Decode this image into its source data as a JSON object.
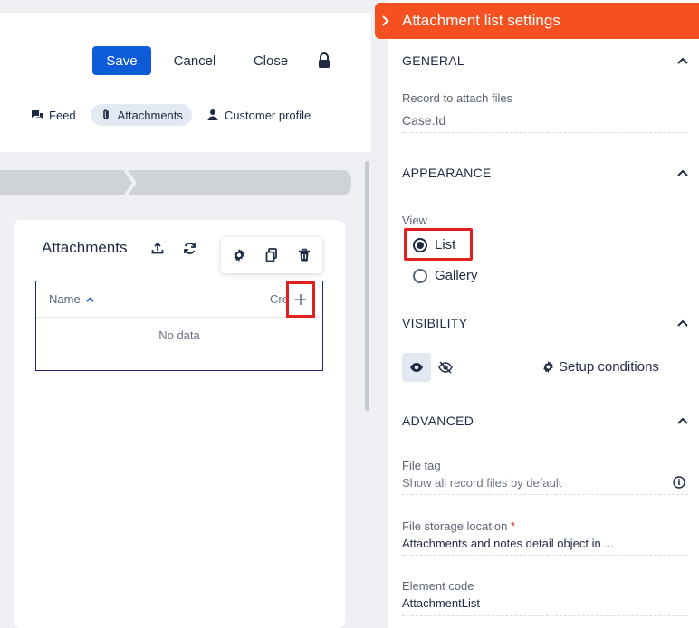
{
  "toolbar": {
    "save_label": "Save",
    "cancel_label": "Cancel",
    "close_label": "Close"
  },
  "tabs": [
    {
      "label": "Feed",
      "icon": "feed-icon",
      "active": false
    },
    {
      "label": "Attachments",
      "icon": "paperclip-icon",
      "active": true
    },
    {
      "label": "Customer profile",
      "icon": "person-icon",
      "active": false
    }
  ],
  "card": {
    "title": "Attachments",
    "table": {
      "col_name": "Name",
      "col_created": "Cre",
      "empty": "No data"
    }
  },
  "panel": {
    "title": "Attachment list settings",
    "general": {
      "title": "GENERAL",
      "record_label": "Record to attach files",
      "record_value": "Case.Id"
    },
    "appearance": {
      "title": "APPEARANCE",
      "view_label": "View",
      "option_list": "List",
      "option_gallery": "Gallery",
      "selected": "List"
    },
    "visibility": {
      "title": "VISIBILITY",
      "setup_label": "Setup conditions"
    },
    "advanced": {
      "title": "ADVANCED",
      "file_tag_label": "File tag",
      "file_tag_value": "Show all record files by default",
      "storage_label": "File storage location",
      "storage_value": "Attachments and notes detail object in ...",
      "code_label": "Element code",
      "code_value": "AttachmentList"
    }
  },
  "colors": {
    "accent": "#f5501f",
    "primary": "#0d5bd7",
    "highlight": "#e02020"
  }
}
